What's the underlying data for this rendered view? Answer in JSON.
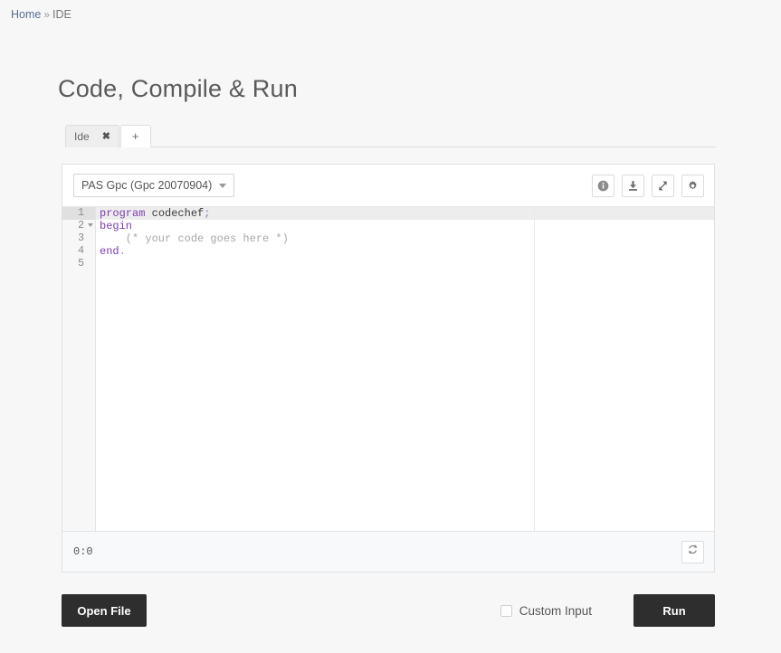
{
  "breadcrumb": {
    "home_label": "Home",
    "separator": "»",
    "current_label": "IDE"
  },
  "page": {
    "title": "Code, Compile & Run"
  },
  "tabs": {
    "items": [
      {
        "label": "Ide",
        "close_glyph": "✖",
        "active": false
      },
      {
        "label": "+",
        "active": true
      }
    ]
  },
  "toolbar": {
    "language": {
      "selected": "PAS Gpc (Gpc 20070904)",
      "caret_icon": "chevron-down-icon"
    },
    "buttons": [
      {
        "name": "info-icon",
        "title": "info"
      },
      {
        "name": "download-icon",
        "title": "download"
      },
      {
        "name": "fullscreen-icon",
        "title": "expand"
      },
      {
        "name": "gear-icon",
        "title": "settings"
      }
    ]
  },
  "editor": {
    "language": "pascal",
    "gutter": [
      {
        "number": "1",
        "active": true,
        "fold": false
      },
      {
        "number": "2",
        "active": false,
        "fold": true
      },
      {
        "number": "3",
        "active": false,
        "fold": false
      },
      {
        "number": "4",
        "active": false,
        "fold": false
      },
      {
        "number": "5",
        "active": false,
        "fold": false
      }
    ],
    "lines": [
      {
        "number": "1",
        "text": "program codechef;"
      },
      {
        "number": "2",
        "text": "begin"
      },
      {
        "number": "3",
        "text": "    (* your code goes here *)"
      },
      {
        "number": "4",
        "text": "end."
      },
      {
        "number": "5",
        "text": ""
      }
    ],
    "syntax_colors": {
      "keyword": "#7d3daa",
      "identifier": "#3a3a3a",
      "punctuation": "#9b7bbf",
      "comment": "#a8a8a8",
      "active_line": "#ededed",
      "gutter_bg": "#f7f7f7"
    }
  },
  "status": {
    "cursor_position": "0:0",
    "refresh_icon": "refresh-icon"
  },
  "actions": {
    "open_file_label": "Open File",
    "custom_input_label": "Custom Input",
    "custom_input_checked": false,
    "run_label": "Run"
  },
  "colors": {
    "page_bg": "#f7f7f7",
    "panel_bg": "#ffffff",
    "button_dark": "#2e2e2e",
    "link": "#5b6e93",
    "title": "#5a5a5a"
  }
}
